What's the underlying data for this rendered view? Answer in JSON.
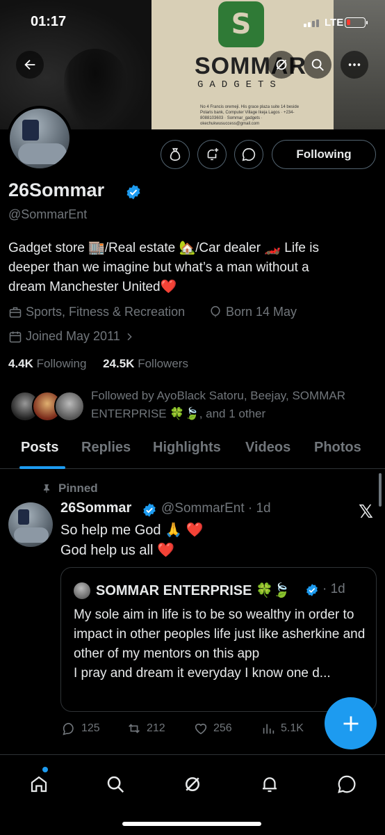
{
  "status_bar": {
    "time": "01:17",
    "network": "LTE",
    "battery_level": 0.2
  },
  "banner": {
    "brand": "SOMMAR",
    "brand_sub": "GADGETS",
    "address": "No 4 Francis oremeji. His grace plaza suite 14 beside Polaris bank, Computer Village Ikeja Lagos · +234-8088103603 · Sommar_gadgets · okechukwusuccess@gmail.com",
    "logo_glyph": "S"
  },
  "header": {
    "back_icon": "arrow-left-icon",
    "grok_icon": "grok-icon",
    "search_icon": "search-icon",
    "more_icon": "more-icon"
  },
  "profile": {
    "display_name": "26Sommar",
    "handle": "@SommarEnt",
    "bio_line1": "Gadget store 🏬/Real estate 🏡/Car dealer 🏎️ Life is",
    "bio_line2": "deeper than we imagine but what’s a man without a",
    "bio_line3": "dream Manchester United❤️",
    "category": "Sports, Fitness & Recreation",
    "birthday": "Born 14 May",
    "joined": "Joined May 2011",
    "following_count": "4.4K",
    "following_label": "Following",
    "followers_count": "24.5K",
    "followers_label": "Followers",
    "followed_by": "Followed by AyoBlack Satoru, Beejay, SOMMAR ENTERPRISE 🍀🍃, and 1 other",
    "follow_button": "Following"
  },
  "tabs": [
    "Posts",
    "Replies",
    "Highlights",
    "Videos",
    "Photos"
  ],
  "pinned_post": {
    "pinned_label": "Pinned",
    "author_name": "26Sommar",
    "author_handle": "@SommarEnt · 1d",
    "text_line1": "So help me God 🙏 ❤️",
    "text_line2": "God help us all ❤️",
    "quote": {
      "author_name": "SOMMAR ENTERPRISE 🍀🍃",
      "time": "· 1d",
      "text": "My sole aim in life is to be so wealthy in order to impact in other peoples life just like asherkine and other of my mentors on this app",
      "text2": "I pray and dream it everyday I know one d..."
    },
    "stats": {
      "replies": "125",
      "reposts": "212",
      "likes": "256",
      "views": "5.1K"
    }
  },
  "bottom_nav": [
    "home-icon",
    "search-icon",
    "grok-icon",
    "notifications-icon",
    "messages-icon"
  ],
  "colors": {
    "accent": "#1d9bf0",
    "background": "#000000",
    "text_primary": "#e7e9ea",
    "text_secondary": "#71767b"
  }
}
